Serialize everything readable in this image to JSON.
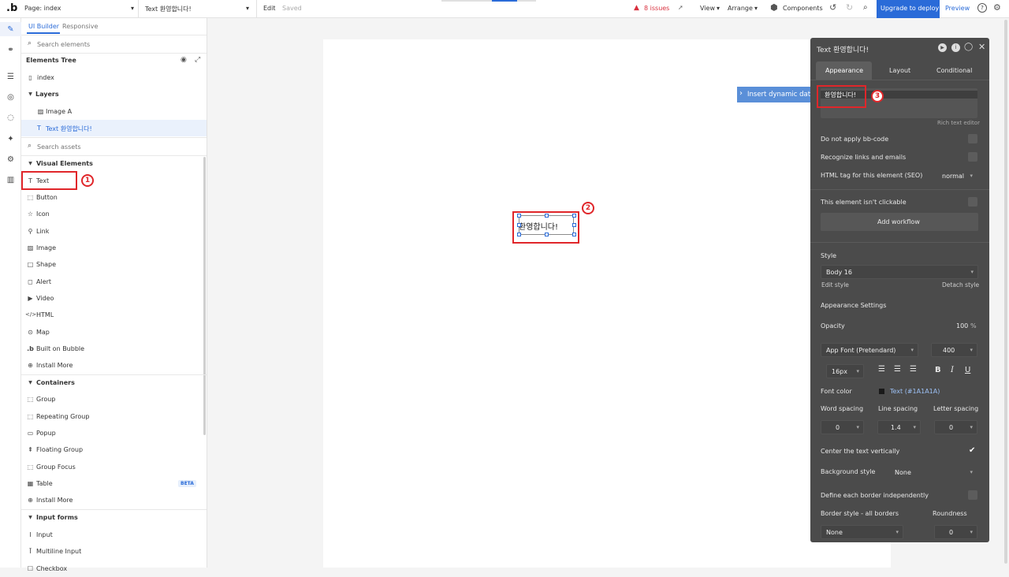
{
  "topbar": {
    "logo": ".b",
    "page_select": "Page: index",
    "element_select": "Text 환영합니다!",
    "edit": "Edit",
    "saved": "Saved",
    "issues": "8 issues",
    "view": "View",
    "arrange": "Arrange",
    "components": "Components",
    "deploy": "Upgrade to deploy",
    "preview": "Preview"
  },
  "left": {
    "tabs": [
      "UI Builder",
      "Responsive"
    ],
    "search_elements_placeholder": "Search elements",
    "elements_tree": "Elements Tree",
    "tree": {
      "index": "index",
      "layers": "Layers",
      "image_a": "Image A",
      "text_item": "Text 환영합니다!"
    },
    "search_assets_placeholder": "Search assets",
    "visual_elements": "Visual Elements",
    "visual_items": [
      "Text",
      "Button",
      "Icon",
      "Link",
      "Image",
      "Shape",
      "Alert",
      "Video",
      "HTML",
      "Map",
      "Built on Bubble",
      "Install More"
    ],
    "containers": "Containers",
    "container_items": [
      "Group",
      "Repeating Group",
      "Popup",
      "Floating Group",
      "Group Focus",
      "Table",
      "Install More"
    ],
    "beta": "BETA",
    "input_forms": "Input forms",
    "input_items": [
      "Input",
      "Multiline Input",
      "Checkbox"
    ]
  },
  "canvas": {
    "text_element": "환영합니다!"
  },
  "insert_dynamic": "Insert dynamic data",
  "prop": {
    "title": "Text 환영합니다!",
    "tabs": [
      "Appearance",
      "Layout",
      "Conditional"
    ],
    "content_value": "환영합니다!",
    "rich_text": "Rich text editor",
    "bbcode": "Do not apply bb-code",
    "links": "Recognize links and emails",
    "html_tag_label": "HTML tag for this element (SEO)",
    "html_tag_value": "normal",
    "not_clickable": "This element isn't clickable",
    "add_workflow": "Add workflow",
    "style_label": "Style",
    "style_value": "Body 16",
    "edit_style": "Edit style",
    "detach_style": "Detach style",
    "appearance_settings": "Appearance Settings",
    "opacity_label": "Opacity",
    "opacity_value": "100",
    "opacity_unit": "%",
    "font_value": "App Font (Pretendard)",
    "weight_value": "400",
    "size_value": "16px",
    "font_color_label": "Font color",
    "font_color_value": "Text (#1A1A1A)",
    "word_spacing": "Word spacing",
    "line_spacing": "Line spacing",
    "letter_spacing": "Letter spacing",
    "word_spacing_value": "0",
    "line_spacing_value": "1.4",
    "letter_spacing_value": "0",
    "center_vertically": "Center the text vertically",
    "background_style": "Background style",
    "background_value": "None",
    "border_independent": "Define each border independently",
    "border_style": "Border style - all borders",
    "roundness": "Roundness",
    "border_value": "None",
    "roundness_value": "0"
  },
  "annotations": [
    "1",
    "2",
    "3"
  ],
  "colors": {
    "accent": "#2a6bd8",
    "annotation_red": "#e0262a",
    "panel_dark": "#4b4b4b",
    "issues_red": "#d9303e"
  }
}
